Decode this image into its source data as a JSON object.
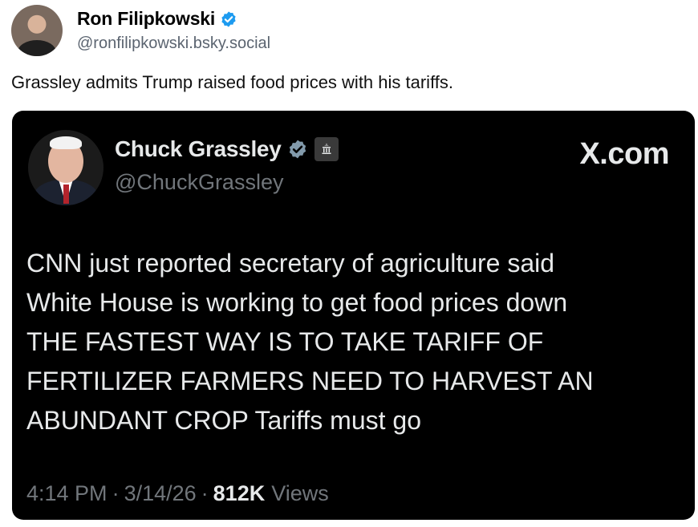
{
  "post": {
    "author_name": "Ron Filipkowski",
    "author_handle": "@ronfilipkowski.bsky.social",
    "text": "Grassley admits Trump raised food prices with his tariffs."
  },
  "embed": {
    "name": "Chuck Grassley",
    "handle": "@ChuckGrassley",
    "source": "X.com",
    "lines": [
      "CNN just reported secretary of agriculture said",
      "White House is working to get food prices down",
      "THE FASTEST WAY IS TO TAKE TARIFF OF",
      "FERTILIZER FARMERS NEED TO HARVEST AN",
      "ABUNDANT CROP  Tariffs must go"
    ],
    "time": "4:14 PM",
    "date": "3/14/26",
    "views_count": "812K",
    "views_label": "Views",
    "separator": "·"
  },
  "colors": {
    "verified_blue": "#1d9bf0",
    "verified_gray": "#829aab",
    "embed_bg": "#000000",
    "embed_text": "#e7e9ea",
    "embed_muted": "#71767b"
  },
  "icons": {
    "author_verified": "verified-check-icon",
    "embed_verified": "verified-check-icon",
    "gov_badge": "government-building-icon"
  }
}
